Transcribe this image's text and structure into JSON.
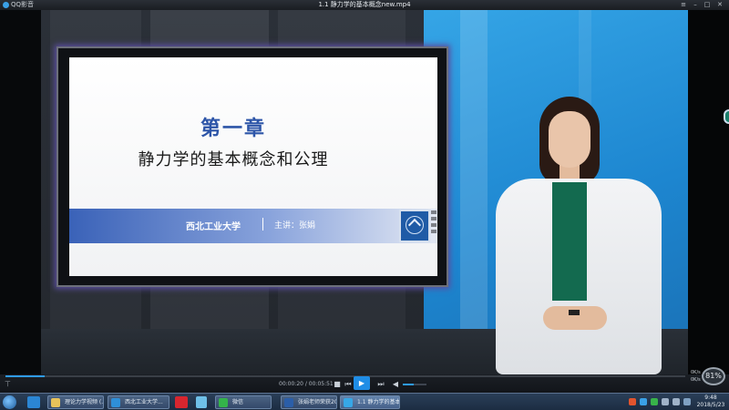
{
  "window": {
    "app_name": "QQ影音",
    "title": "1.1 静力学的基本概念new.mp4",
    "buttons": {
      "menu": "≡",
      "minimize": "–",
      "maximize": "□",
      "close": "✕"
    }
  },
  "slide": {
    "chapter": "第一章",
    "subtitle": "静力学的基本概念和公理",
    "university": "西北工业大学",
    "speaker": "主讲：张娟"
  },
  "player": {
    "current_time": "00:00:20",
    "total_time": "00:05:51",
    "time_separator": " / ",
    "progress_fraction": 0.057,
    "volume_fraction": 0.45,
    "speed_label": "81%",
    "net_up": "0K/s",
    "net_down": "0K/s",
    "icons": [
      "pin-icon",
      "stop-icon",
      "prev-icon",
      "play-icon",
      "next-icon",
      "volume-icon"
    ]
  },
  "taskbar": {
    "tasks": [
      {
        "label": "理论力学视频 (...",
        "icon": "folder-icon",
        "color": "#e8c25a"
      },
      {
        "label": "西北工业大学...",
        "icon": "sogou-browser-icon",
        "color": "#2f8fd8"
      },
      {
        "label": "微信",
        "icon": "wechat-icon",
        "color": "#34b34a"
      },
      {
        "label": "张娟老师荣获201...",
        "icon": "word-icon",
        "color": "#2b5ea8"
      },
      {
        "label": "1.1 静力学的基本...",
        "icon": "qq-player-icon",
        "color": "#37a7e6"
      }
    ],
    "clock_time": "9:48",
    "clock_date": "2018/5/23"
  },
  "colors": {
    "accent": "#1f8de6",
    "slide_title": "#2d55a8",
    "band_start": "#3a62b8",
    "presenter_shirt": "#136a4f"
  }
}
